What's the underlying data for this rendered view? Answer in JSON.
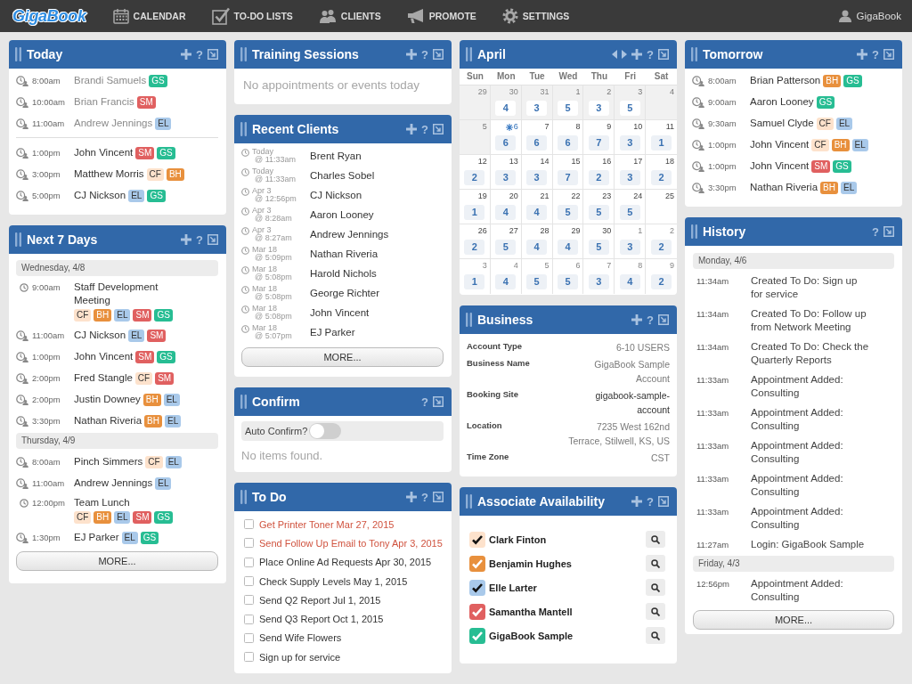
{
  "top_bar": {
    "logo": "GigaBook",
    "nav": [
      {
        "label": "CALENDAR"
      },
      {
        "label": "TO-DO LISTS"
      },
      {
        "label": "CLIENTS"
      },
      {
        "label": "PROMOTE"
      },
      {
        "label": "SETTINGS"
      }
    ],
    "user": "GigaBook"
  },
  "columns": [
    {
      "panels": [
        {
          "kind": "appointments",
          "title": "Today",
          "actions": [
            {
              "kind": "add"
            },
            {
              "kind": "help",
              "label": "?"
            },
            {
              "kind": "minimize"
            }
          ],
          "rows": [
            {
              "time": "8:00am",
              "name": "Brandi Samuels",
              "past": true,
              "tags": [
                {
                  "label": "GS",
                  "color": "#27bd93"
                }
              ]
            },
            {
              "time": "10:00am",
              "name": "Brian Francis",
              "past": true,
              "tags": [
                {
                  "label": "SM",
                  "color": "#e06060"
                }
              ]
            },
            {
              "time": "11:00am",
              "name": "Andrew Jennings",
              "past": true,
              "tags": [
                {
                  "label": "EL",
                  "color": "#a9c9ea"
                }
              ]
            },
            {
              "time": "1:00pm",
              "name": "John Vincent",
              "past": false,
              "tags": [
                {
                  "label": "SM",
                  "color": "#e06060"
                },
                {
                  "label": "GS",
                  "color": "#27bd93"
                }
              ]
            },
            {
              "time": "3:00pm",
              "name": "Matthew Morris",
              "past": false,
              "tags": [
                {
                  "label": "CF",
                  "color": "#fde2cc"
                },
                {
                  "label": "BH",
                  "color": "#e8903d"
                }
              ]
            },
            {
              "time": "5:00pm",
              "name": "CJ Nickson",
              "past": false,
              "tags": [
                {
                  "label": "EL",
                  "color": "#a9c9ea"
                },
                {
                  "label": "GS",
                  "color": "#27bd93"
                }
              ]
            }
          ]
        },
        {
          "kind": "agenda",
          "title": "Next 7 Days",
          "actions": [
            {
              "kind": "add"
            },
            {
              "kind": "help",
              "label": "?"
            },
            {
              "kind": "minimize"
            }
          ],
          "days": [
            {
              "label": "Wednesday, 4/8",
              "rows": [
                {
                  "kind": "event",
                  "time": "9:00am",
                  "name": "Staff Development Meeting",
                  "tags": [
                    {
                      "label": "CF",
                      "color": "#fde2cc"
                    },
                    {
                      "label": "BH",
                      "color": "#e8903d"
                    },
                    {
                      "label": "EL",
                      "color": "#a9c9ea"
                    },
                    {
                      "label": "SM",
                      "color": "#e06060"
                    },
                    {
                      "label": "GS",
                      "color": "#27bd93"
                    }
                  ]
                },
                {
                  "kind": "appointment",
                  "time": "11:00am",
                  "name": "CJ Nickson",
                  "tags": [
                    {
                      "label": "EL",
                      "color": "#a9c9ea"
                    },
                    {
                      "label": "SM",
                      "color": "#e06060"
                    }
                  ]
                },
                {
                  "kind": "appointment",
                  "time": "1:00pm",
                  "name": "John Vincent",
                  "tags": [
                    {
                      "label": "SM",
                      "color": "#e06060"
                    },
                    {
                      "label": "GS",
                      "color": "#27bd93"
                    }
                  ]
                },
                {
                  "kind": "appointment",
                  "time": "2:00pm",
                  "name": "Fred Stangle",
                  "tags": [
                    {
                      "label": "CF",
                      "color": "#fde2cc"
                    },
                    {
                      "label": "SM",
                      "color": "#e06060"
                    }
                  ]
                },
                {
                  "kind": "appointment",
                  "time": "2:00pm",
                  "name": "Justin Downey",
                  "tags": [
                    {
                      "label": "BH",
                      "color": "#e8903d"
                    },
                    {
                      "label": "EL",
                      "color": "#a9c9ea"
                    }
                  ]
                },
                {
                  "kind": "appointment",
                  "time": "3:30pm",
                  "name": "Nathan Riveria",
                  "tags": [
                    {
                      "label": "BH",
                      "color": "#e8903d"
                    },
                    {
                      "label": "EL",
                      "color": "#a9c9ea"
                    }
                  ]
                }
              ]
            },
            {
              "label": "Thursday, 4/9",
              "rows": [
                {
                  "kind": "appointment",
                  "time": "8:00am",
                  "name": "Pinch Simmers",
                  "tags": [
                    {
                      "label": "CF",
                      "color": "#fde2cc"
                    },
                    {
                      "label": "EL",
                      "color": "#a9c9ea"
                    }
                  ]
                },
                {
                  "kind": "appointment",
                  "time": "11:00am",
                  "name": "Andrew Jennings",
                  "tags": [
                    {
                      "label": "EL",
                      "color": "#a9c9ea"
                    }
                  ]
                },
                {
                  "kind": "event",
                  "time": "12:00pm",
                  "name": "Team Lunch",
                  "tags": [
                    {
                      "label": "CF",
                      "color": "#fde2cc"
                    },
                    {
                      "label": "BH",
                      "color": "#e8903d"
                    },
                    {
                      "label": "EL",
                      "color": "#a9c9ea"
                    },
                    {
                      "label": "SM",
                      "color": "#e06060"
                    },
                    {
                      "label": "GS",
                      "color": "#27bd93"
                    }
                  ]
                },
                {
                  "kind": "appointment",
                  "time": "1:30pm",
                  "name": "EJ Parker",
                  "tags": [
                    {
                      "label": "EL",
                      "color": "#a9c9ea"
                    },
                    {
                      "label": "GS",
                      "color": "#27bd93"
                    }
                  ]
                }
              ]
            }
          ],
          "more": "MORE..."
        }
      ]
    },
    {
      "panels": [
        {
          "kind": "message",
          "title": "Training Sessions",
          "actions": [
            {
              "kind": "add"
            },
            {
              "kind": "help",
              "label": "?"
            },
            {
              "kind": "minimize"
            }
          ],
          "message": "No appointments or events today"
        },
        {
          "kind": "recent_clients",
          "title": "Recent Clients",
          "actions": [
            {
              "kind": "add"
            },
            {
              "kind": "help",
              "label": "?"
            },
            {
              "kind": "minimize"
            }
          ],
          "rows": [
            {
              "date": "Today",
              "time": "@ 11:33am",
              "name": "Brent Ryan"
            },
            {
              "date": "Today",
              "time": "@ 11:33am",
              "name": "Charles Sobel"
            },
            {
              "date": "Apr 3",
              "time": "@ 12:56pm",
              "name": "CJ Nickson"
            },
            {
              "date": "Apr 3",
              "time": "@ 8:28am",
              "name": "Aaron Looney"
            },
            {
              "date": "Apr 3",
              "time": "@ 8:27am",
              "name": "Andrew Jennings"
            },
            {
              "date": "Mar 18",
              "time": "@ 5:09pm",
              "name": "Nathan Riveria"
            },
            {
              "date": "Mar 18",
              "time": "@ 5:08pm",
              "name": "Harold Nichols"
            },
            {
              "date": "Mar 18",
              "time": "@ 5:08pm",
              "name": "George Richter"
            },
            {
              "date": "Mar 18",
              "time": "@ 5:08pm",
              "name": "John Vincent"
            },
            {
              "date": "Mar 18",
              "time": "@ 5:07pm",
              "name": "EJ Parker"
            }
          ],
          "more": "MORE..."
        },
        {
          "kind": "confirm",
          "title": "Confirm",
          "actions": [
            {
              "kind": "help",
              "label": "?"
            },
            {
              "kind": "minimize"
            }
          ],
          "toggle": {
            "label": "Auto Confirm?",
            "on": false
          },
          "message": "No items found."
        },
        {
          "kind": "todo",
          "title": "To Do",
          "actions": [
            {
              "kind": "add"
            },
            {
              "kind": "help",
              "label": "?"
            },
            {
              "kind": "minimize"
            }
          ],
          "items": [
            {
              "text": "Get Printer Toner Mar 27, 2015",
              "overdue": true,
              "checked": false
            },
            {
              "text": "Send Follow Up Email to Tony Apr 3, 2015",
              "overdue": true,
              "checked": false
            },
            {
              "text": "Place Online Ad Requests Apr 30, 2015",
              "overdue": false,
              "checked": false
            },
            {
              "text": "Check Supply Levels May 1, 2015",
              "overdue": false,
              "checked": false
            },
            {
              "text": "Send Q2 Report Jul 1, 2015",
              "overdue": false,
              "checked": false
            },
            {
              "text": "Send Q3 Report Oct 1, 2015",
              "overdue": false,
              "checked": false
            },
            {
              "text": "Send Wife Flowers",
              "overdue": false,
              "checked": false
            },
            {
              "text": "Sign up for service",
              "overdue": false,
              "checked": false
            }
          ]
        }
      ]
    },
    {
      "panels": [
        {
          "kind": "calendar",
          "title": "April",
          "actions": [
            {
              "kind": "prev"
            },
            {
              "kind": "next"
            },
            {
              "kind": "add"
            },
            {
              "kind": "help",
              "label": "?"
            },
            {
              "kind": "minimize"
            }
          ],
          "weekdays": [
            "Sun",
            "Mon",
            "Tue",
            "Wed",
            "Thu",
            "Fri",
            "Sat"
          ],
          "weeks": [
            {
              "days": [
                {
                  "date": "29",
                  "past": true,
                  "other_month": true,
                  "today": false
                },
                {
                  "date": "30",
                  "count": "4",
                  "past": true,
                  "other_month": true,
                  "today": false
                },
                {
                  "date": "31",
                  "count": "3",
                  "past": true,
                  "other_month": true,
                  "today": false
                },
                {
                  "date": "1",
                  "count": "5",
                  "past": true,
                  "other_month": false,
                  "today": false
                },
                {
                  "date": "2",
                  "count": "3",
                  "past": true,
                  "other_month": false,
                  "today": false
                },
                {
                  "date": "3",
                  "count": "5",
                  "past": true,
                  "other_month": false,
                  "today": false
                },
                {
                  "date": "4",
                  "past": true,
                  "other_month": false,
                  "today": false
                }
              ]
            },
            {
              "days": [
                {
                  "date": "5",
                  "past": true,
                  "other_month": false,
                  "today": false
                },
                {
                  "date": "6",
                  "count": "6",
                  "past": false,
                  "other_month": false,
                  "today": true
                },
                {
                  "date": "7",
                  "count": "6",
                  "past": false,
                  "other_month": false,
                  "today": false
                },
                {
                  "date": "8",
                  "count": "6",
                  "past": false,
                  "other_month": false,
                  "today": false
                },
                {
                  "date": "9",
                  "count": "7",
                  "past": false,
                  "other_month": false,
                  "today": false
                },
                {
                  "date": "10",
                  "count": "3",
                  "past": false,
                  "other_month": false,
                  "today": false
                },
                {
                  "date": "11",
                  "count": "1",
                  "past": false,
                  "other_month": false,
                  "today": false
                }
              ]
            },
            {
              "days": [
                {
                  "date": "12",
                  "count": "2",
                  "past": false,
                  "other_month": false,
                  "today": false
                },
                {
                  "date": "13",
                  "count": "3",
                  "past": false,
                  "other_month": false,
                  "today": false
                },
                {
                  "date": "14",
                  "count": "3",
                  "past": false,
                  "other_month": false,
                  "today": false
                },
                {
                  "date": "15",
                  "count": "7",
                  "past": false,
                  "other_month": false,
                  "today": false
                },
                {
                  "date": "16",
                  "count": "2",
                  "past": false,
                  "other_month": false,
                  "today": false
                },
                {
                  "date": "17",
                  "count": "3",
                  "past": false,
                  "other_month": false,
                  "today": false
                },
                {
                  "date": "18",
                  "count": "2",
                  "past": false,
                  "other_month": false,
                  "today": false
                }
              ]
            },
            {
              "days": [
                {
                  "date": "19",
                  "count": "1",
                  "past": false,
                  "other_month": false,
                  "today": false
                },
                {
                  "date": "20",
                  "count": "4",
                  "past": false,
                  "other_month": false,
                  "today": false
                },
                {
                  "date": "21",
                  "count": "4",
                  "past": false,
                  "other_month": false,
                  "today": false
                },
                {
                  "date": "22",
                  "count": "5",
                  "past": false,
                  "other_month": false,
                  "today": false
                },
                {
                  "date": "23",
                  "count": "5",
                  "past": false,
                  "other_month": false,
                  "today": false
                },
                {
                  "date": "24",
                  "count": "5",
                  "past": false,
                  "other_month": false,
                  "today": false
                },
                {
                  "date": "25",
                  "past": false,
                  "other_month": false,
                  "today": false
                }
              ]
            },
            {
              "days": [
                {
                  "date": "26",
                  "count": "2",
                  "past": false,
                  "other_month": false,
                  "today": false
                },
                {
                  "date": "27",
                  "count": "5",
                  "past": false,
                  "other_month": false,
                  "today": false
                },
                {
                  "date": "28",
                  "count": "4",
                  "past": false,
                  "other_month": false,
                  "today": false
                },
                {
                  "date": "29",
                  "count": "4",
                  "past": false,
                  "other_month": false,
                  "today": false
                },
                {
                  "date": "30",
                  "count": "5",
                  "past": false,
                  "other_month": false,
                  "today": false
                },
                {
                  "date": "1",
                  "count": "3",
                  "past": false,
                  "other_month": true,
                  "today": false
                },
                {
                  "date": "2",
                  "count": "2",
                  "past": false,
                  "other_month": true,
                  "today": false
                }
              ]
            },
            {
              "days": [
                {
                  "date": "3",
                  "count": "1",
                  "past": false,
                  "other_month": true,
                  "today": false
                },
                {
                  "date": "4",
                  "count": "4",
                  "past": false,
                  "other_month": true,
                  "today": false
                },
                {
                  "date": "5",
                  "count": "5",
                  "past": false,
                  "other_month": true,
                  "today": false
                },
                {
                  "date": "6",
                  "count": "5",
                  "past": false,
                  "other_month": true,
                  "today": false
                },
                {
                  "date": "7",
                  "count": "3",
                  "past": false,
                  "other_month": true,
                  "today": false
                },
                {
                  "date": "8",
                  "count": "4",
                  "past": false,
                  "other_month": true,
                  "today": false
                },
                {
                  "date": "9",
                  "count": "2",
                  "past": false,
                  "other_month": true,
                  "today": false
                }
              ]
            }
          ]
        },
        {
          "kind": "business",
          "title": "Business",
          "actions": [
            {
              "kind": "add"
            },
            {
              "kind": "help",
              "label": "?"
            },
            {
              "kind": "minimize"
            }
          ],
          "fields": [
            {
              "label": "Account Type",
              "value": "6-10 USERS",
              "kind": "text"
            },
            {
              "label": "Business Name",
              "value": "GigaBook Sample Account",
              "kind": "text"
            },
            {
              "label": "Booking Site",
              "value": "gigabook-sample-account",
              "kind": "link"
            },
            {
              "label": "Location",
              "value": "7235 West 162nd Terrace, Stilwell, KS, US",
              "kind": "text"
            },
            {
              "label": "Time Zone",
              "value": "CST",
              "kind": "text"
            }
          ]
        },
        {
          "kind": "associates",
          "title": "Associate Availability",
          "actions": [
            {
              "kind": "add"
            },
            {
              "kind": "help",
              "label": "?"
            },
            {
              "kind": "minimize"
            }
          ],
          "items": [
            {
              "name": "Clark Finton",
              "checked": true,
              "color": "#fde2cc"
            },
            {
              "name": "Benjamin Hughes",
              "checked": true,
              "color": "#e8903d"
            },
            {
              "name": "Elle Larter",
              "checked": true,
              "color": "#a9c9ea"
            },
            {
              "name": "Samantha Mantell",
              "checked": true,
              "color": "#e06060"
            },
            {
              "name": "GigaBook Sample",
              "checked": true,
              "color": "#27bd93"
            }
          ]
        }
      ]
    },
    {
      "panels": [
        {
          "kind": "appointments",
          "title": "Tomorrow",
          "actions": [
            {
              "kind": "add"
            },
            {
              "kind": "help",
              "label": "?"
            },
            {
              "kind": "minimize"
            }
          ],
          "rows": [
            {
              "time": "8:00am",
              "name": "Brian Patterson",
              "past": false,
              "tags": [
                {
                  "label": "BH",
                  "color": "#e8903d"
                },
                {
                  "label": "GS",
                  "color": "#27bd93"
                }
              ]
            },
            {
              "time": "9:00am",
              "name": "Aaron Looney",
              "past": false,
              "tags": [
                {
                  "label": "GS",
                  "color": "#27bd93"
                }
              ]
            },
            {
              "time": "9:30am",
              "name": "Samuel Clyde",
              "past": false,
              "tags": [
                {
                  "label": "CF",
                  "color": "#fde2cc"
                },
                {
                  "label": "EL",
                  "color": "#a9c9ea"
                }
              ]
            },
            {
              "time": "1:00pm",
              "name": "John Vincent",
              "past": false,
              "tags": [
                {
                  "label": "CF",
                  "color": "#fde2cc"
                },
                {
                  "label": "BH",
                  "color": "#e8903d"
                },
                {
                  "label": "EL",
                  "color": "#a9c9ea"
                }
              ]
            },
            {
              "time": "1:00pm",
              "name": "John Vincent",
              "past": false,
              "tags": [
                {
                  "label": "SM",
                  "color": "#e06060"
                },
                {
                  "label": "GS",
                  "color": "#27bd93"
                }
              ]
            },
            {
              "time": "3:30pm",
              "name": "Nathan Riveria",
              "past": false,
              "tags": [
                {
                  "label": "BH",
                  "color": "#e8903d"
                },
                {
                  "label": "EL",
                  "color": "#a9c9ea"
                }
              ]
            }
          ]
        },
        {
          "kind": "history",
          "title": "History",
          "actions": [
            {
              "kind": "help",
              "label": "?"
            },
            {
              "kind": "minimize"
            }
          ],
          "days": [
            {
              "label": "Monday, 4/6",
              "entries": [
                {
                  "time": "11:34am",
                  "text": "Created To Do: Sign up for service"
                },
                {
                  "time": "11:34am",
                  "text": "Created To Do: Follow up from Network Meeting"
                },
                {
                  "time": "11:34am",
                  "text": "Created To Do: Check the Quarterly Reports"
                },
                {
                  "time": "11:33am",
                  "text": "Appointment Added: Consulting"
                },
                {
                  "time": "11:33am",
                  "text": "Appointment Added: Consulting"
                },
                {
                  "time": "11:33am",
                  "text": "Appointment Added: Consulting"
                },
                {
                  "time": "11:33am",
                  "text": "Appointment Added: Consulting"
                },
                {
                  "time": "11:33am",
                  "text": "Appointment Added: Consulting"
                },
                {
                  "time": "11:27am",
                  "text": "Login: GigaBook Sample"
                }
              ]
            },
            {
              "label": "Friday, 4/3",
              "entries": [
                {
                  "time": "12:56pm",
                  "text": "Appointment Added: Consulting"
                }
              ]
            }
          ],
          "more": "MORE..."
        }
      ]
    }
  ]
}
